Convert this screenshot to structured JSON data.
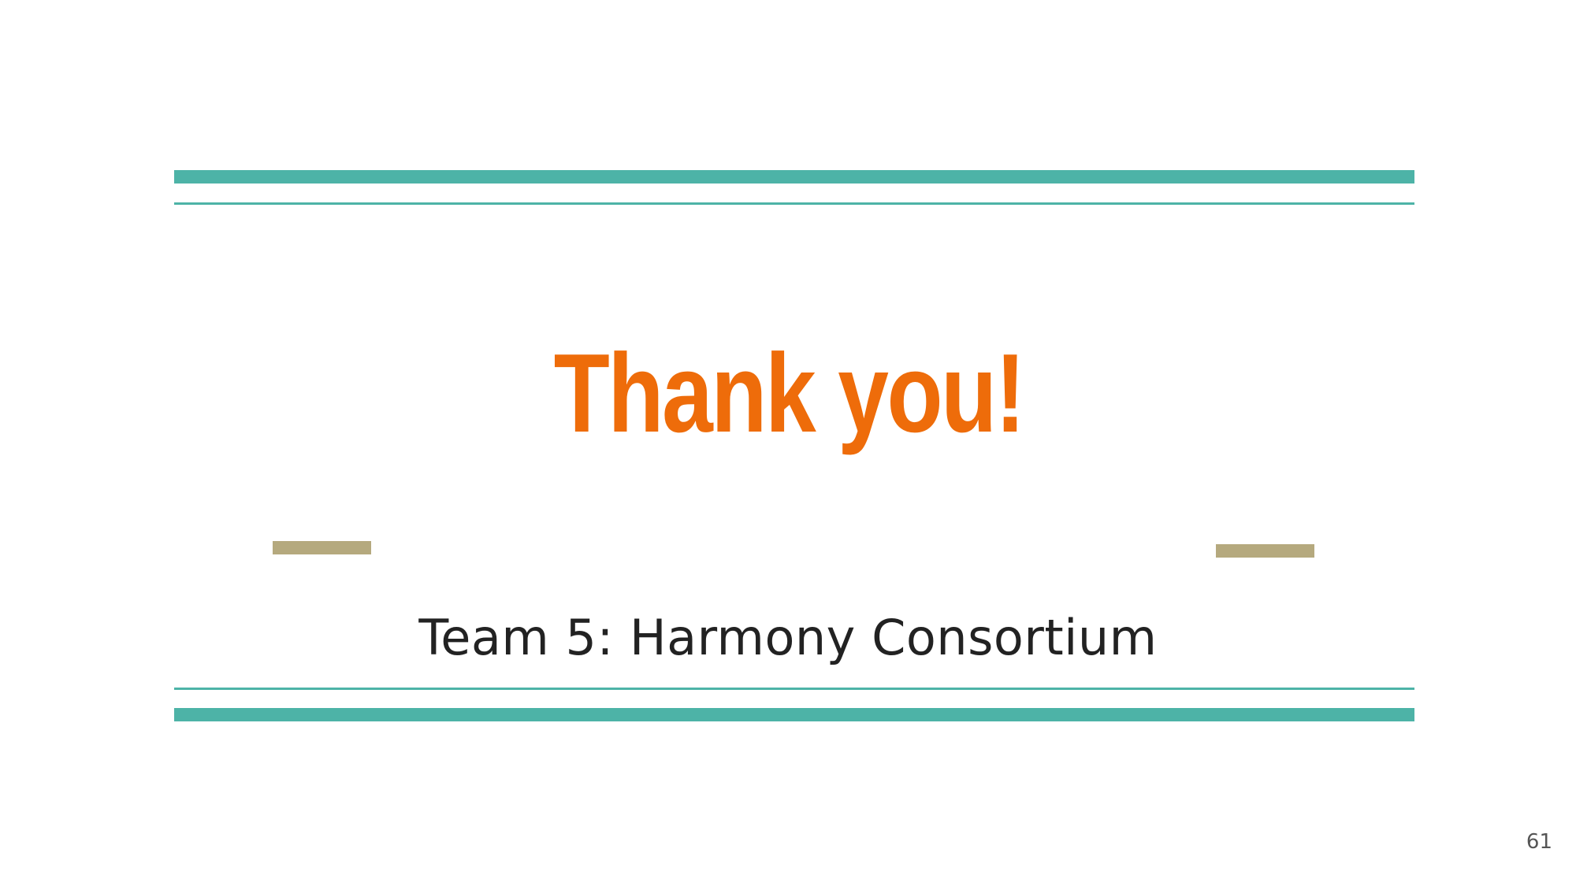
{
  "slide": {
    "title": "Thank you!",
    "subtitle": "Team 5: Harmony Consortium",
    "page_number": "61"
  },
  "colors": {
    "accent_rule": "#4db3a7",
    "accent_dash": "#b5a97e",
    "title": "#ee6c0a",
    "subtitle": "#222222",
    "page_number": "#555555",
    "background": "#ffffff"
  }
}
